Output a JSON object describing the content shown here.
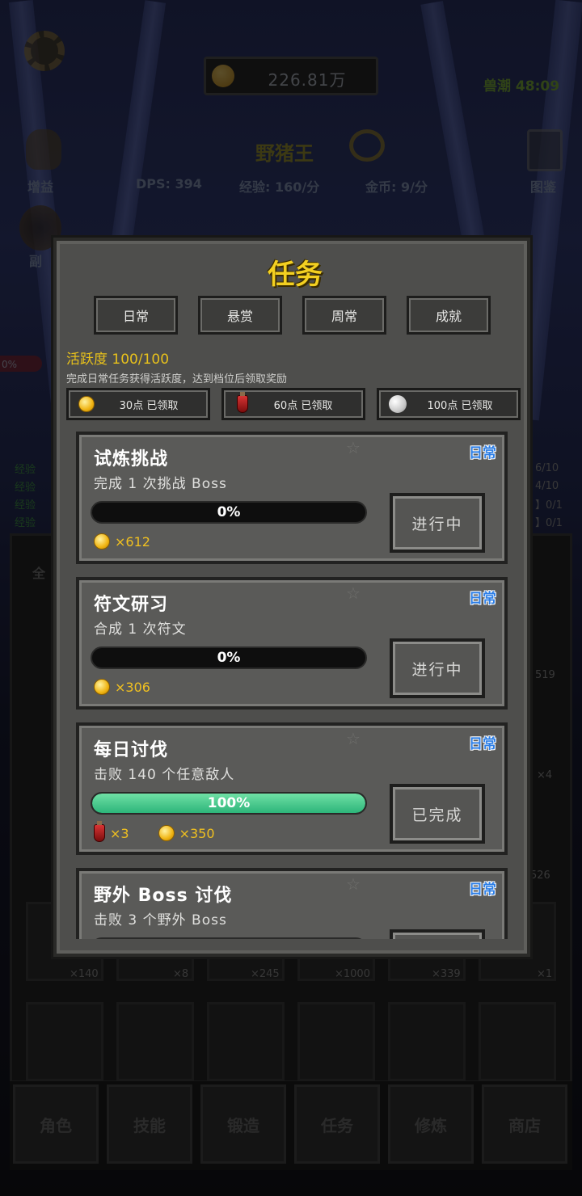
{
  "hud": {
    "gold_amount": "226.81万",
    "wave_timer": "兽潮 48:09",
    "boss_name": "野猪王",
    "left_icon_label": "增益",
    "right_icon_label": "图鉴",
    "dps": "DPS: 394",
    "exp_rate": "经验: 160/分",
    "gold_rate": "金币: 9/分",
    "side_label": "副",
    "hp_stub": "0%",
    "exp_rows": [
      "经验",
      "经验",
      "经验",
      "经验"
    ],
    "exp_counts": [
      "6/10",
      "4/10",
      "】0/1",
      "】0/1"
    ],
    "filter_stub": "全"
  },
  "inventory": {
    "counts_row1": [
      "519"
    ],
    "counts_row2": [
      "×4"
    ],
    "counts_row3": [
      "526"
    ],
    "counts_row4": [
      "×140",
      "×8",
      "×245",
      "×1000",
      "×339",
      "×1"
    ]
  },
  "bottom_nav": [
    "角色",
    "技能",
    "锻造",
    "任务",
    "修炼",
    "商店"
  ],
  "dialog": {
    "title": "任务",
    "tabs": [
      "日常",
      "悬赏",
      "周常",
      "成就"
    ],
    "activity": {
      "label": "活跃度 100/100",
      "description": "完成日常任务获得活跃度，达到档位后领取奖励",
      "rewards": [
        {
          "icon": "coin-icon",
          "text": "30点 已领取"
        },
        {
          "icon": "potion-icon",
          "text": "60点 已领取"
        },
        {
          "icon": "pearl-icon",
          "text": "100点 已领取"
        }
      ]
    },
    "tasks": [
      {
        "title": "试炼挑战",
        "tag": "日常",
        "desc": "完成 1 次挑战 Boss",
        "progress": 0,
        "progress_label": "0%",
        "rewards": [
          {
            "icon": "coin-icon",
            "amount": "×612"
          }
        ],
        "button": "进行中"
      },
      {
        "title": "符文研习",
        "tag": "日常",
        "desc": "合成 1 次符文",
        "progress": 0,
        "progress_label": "0%",
        "rewards": [
          {
            "icon": "coin-icon",
            "amount": "×306"
          }
        ],
        "button": "进行中"
      },
      {
        "title": "每日讨伐",
        "tag": "日常",
        "desc": "击败 140 个任意敌人",
        "progress": 100,
        "progress_label": "100%",
        "rewards": [
          {
            "icon": "potion-icon",
            "amount": "×3"
          },
          {
            "icon": "coin-icon",
            "amount": "×350"
          }
        ],
        "button": "已完成"
      },
      {
        "title": "野外 Boss 讨伐",
        "tag": "日常",
        "desc": "击败 3 个野外 Boss",
        "progress": 100,
        "progress_label": "",
        "rewards": [],
        "button": ""
      }
    ]
  },
  "colors": {
    "accent_gold": "#f3d021",
    "activity_text": "#e8c11b",
    "tag_blue": "#2e7fe6",
    "progress_green": "#2db57a",
    "reward_amount": "#f0c020"
  }
}
